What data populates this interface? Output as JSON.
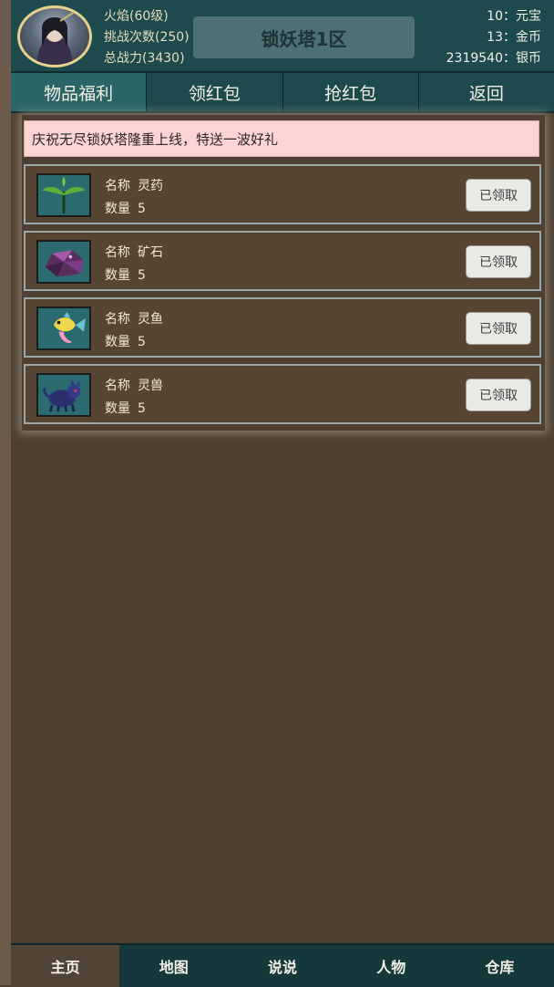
{
  "player": {
    "name_level": "火焰(60级)",
    "challenges": "挑战次数(250)",
    "power": "总战力(3430)"
  },
  "server": {
    "title": "锁妖塔1区"
  },
  "currency": {
    "yuanbao": "10：元宝",
    "gold": "13：金币",
    "silver": "2319540：银币"
  },
  "tabs": [
    {
      "label": "物品福利",
      "active": true
    },
    {
      "label": "领红包",
      "active": false
    },
    {
      "label": "抢红包",
      "active": false
    },
    {
      "label": "返回",
      "active": false
    }
  ],
  "notice": "庆祝无尽锁妖塔隆重上线，特送一波好礼",
  "items": [
    {
      "name_label": "名称",
      "name": "灵药",
      "qty_label": "数量",
      "qty": "5",
      "button": "已领取",
      "icon": "herb-icon"
    },
    {
      "name_label": "名称",
      "name": "矿石",
      "qty_label": "数量",
      "qty": "5",
      "button": "已领取",
      "icon": "ore-icon"
    },
    {
      "name_label": "名称",
      "name": "灵鱼",
      "qty_label": "数量",
      "qty": "5",
      "button": "已领取",
      "icon": "fish-icon"
    },
    {
      "name_label": "名称",
      "name": "灵兽",
      "qty_label": "数量",
      "qty": "5",
      "button": "已领取",
      "icon": "beast-icon"
    }
  ],
  "bottom_nav": [
    {
      "label": "主页",
      "active": true
    },
    {
      "label": "地图",
      "active": false
    },
    {
      "label": "说说",
      "active": false
    },
    {
      "label": "人物",
      "active": false
    },
    {
      "label": "仓库",
      "active": false
    }
  ],
  "colors": {
    "background": "#4d4033",
    "header": "#1d4a4c",
    "notice_bg": "#fcd4d3",
    "item_bg": "#574533"
  }
}
